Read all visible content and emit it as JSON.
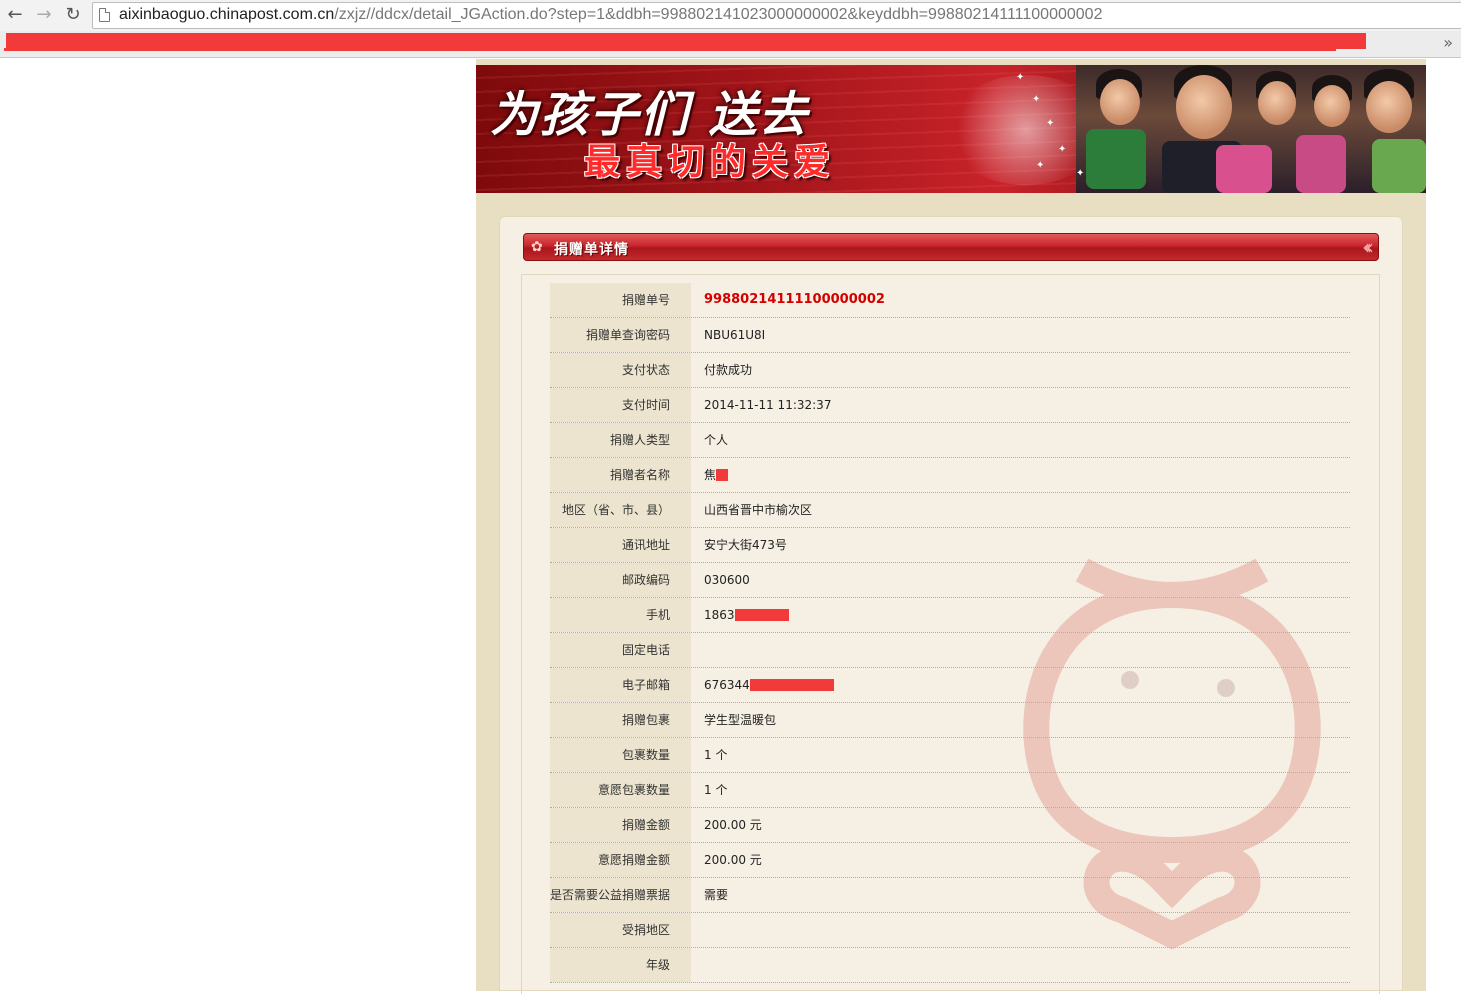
{
  "browser": {
    "url_prefix": "aixinbaoguo.chinapost.com.cn",
    "url_path": "/zxjz//ddcx/detail_JGAction.do?step=1&ddbh=998802141023000000002&keyddbh=99880214111100000002"
  },
  "banner": {
    "line1": "为孩子们 送去",
    "line2": "最真切的关爱"
  },
  "section": {
    "title": "捐赠单详情"
  },
  "details": [
    {
      "label": "捐赠单号",
      "value": "99880214111100000002",
      "highlight": true
    },
    {
      "label": "捐赠单查询密码",
      "value": "NBU61U8I"
    },
    {
      "label": "支付状态",
      "value": "付款成功"
    },
    {
      "label": "支付时间",
      "value": "2014-11-11 11:32:37"
    },
    {
      "label": "捐赠人类型",
      "value": "个人"
    },
    {
      "label": "捐赠者名称",
      "value": "焦"
    },
    {
      "label": "地区（省、市、县）",
      "value": "山西省晋中市榆次区"
    },
    {
      "label": "通讯地址",
      "value": "安宁大街473号"
    },
    {
      "label": "邮政编码",
      "value": "030600"
    },
    {
      "label": "手机",
      "value": "1863"
    },
    {
      "label": "固定电话",
      "value": ""
    },
    {
      "label": "电子邮箱",
      "value": "676344"
    },
    {
      "label": "捐赠包裹",
      "value": "学生型温暖包"
    },
    {
      "label": "包裹数量",
      "value": "1 个"
    },
    {
      "label": "意愿包裹数量",
      "value": "1 个"
    },
    {
      "label": "捐赠金额",
      "value": "200.00 元"
    },
    {
      "label": "意愿捐赠金额",
      "value": "200.00 元"
    },
    {
      "label": "是否需要公益捐赠票据",
      "value": "需要"
    },
    {
      "label": "受捐地区",
      "value": ""
    },
    {
      "label": "年级",
      "value": ""
    }
  ],
  "colors": {
    "accent": "#c7262b",
    "page_bg": "#e8dfc3",
    "panel_bg": "#f6f0e4",
    "label_bg": "#ece4cf",
    "highlight": "#d40000",
    "redaction": "#f23a3a"
  }
}
